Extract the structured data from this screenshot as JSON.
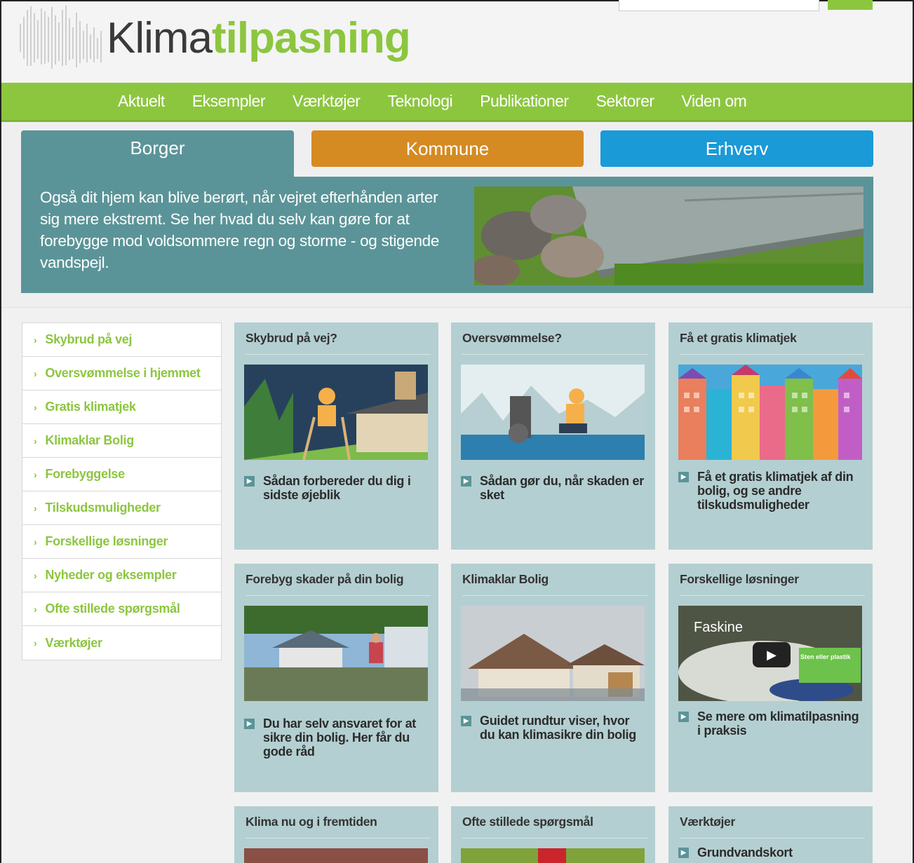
{
  "brand": {
    "logo_part1": "Klima",
    "logo_part2": "tilpasning"
  },
  "nav": [
    "Aktuelt",
    "Eksempler",
    "Værktøjer",
    "Teknologi",
    "Publikationer",
    "Sektorer",
    "Viden om"
  ],
  "tabs": {
    "borger": "Borger",
    "kommune": "Kommune",
    "erhverv": "Erhverv"
  },
  "hero": {
    "text": "Også dit hjem kan blive berørt, når vejret efterhånden arter sig mere ekstremt. Se her hvad du selv kan gøre for at forebygge mod voldsommere regn og storme - og stigende vandspejl."
  },
  "sidebar": [
    "Skybrud på vej",
    "Oversvømmelse i hjemmet",
    "Gratis klimatjek",
    "Klimaklar Bolig",
    "Forebyggelse",
    "Tilskudsmuligheder",
    "Forskellige løsninger",
    "Nyheder og eksempler",
    "Ofte stillede spørgsmål",
    "Værktøjer"
  ],
  "cards": [
    {
      "title": "Skybrud på vej?",
      "link": "Sådan forbereder du dig i sidste øjeblik"
    },
    {
      "title": "Oversvømmelse?",
      "link": "Sådan gør du, når skaden er sket"
    },
    {
      "title": "Få et gratis klimatjek",
      "link": "Få et gratis klimatjek af din bolig, og se andre tilskudsmuligheder"
    },
    {
      "title": "Forebyg skader på din bolig",
      "link": "Du har selv ansvaret for at sikre din bolig. Her får du gode råd"
    },
    {
      "title": "Klimaklar Bolig",
      "link": "Guidet rundtur viser, hvor du kan klimasikre din bolig"
    },
    {
      "title": "Forskellige løsninger",
      "link": "Se mere om klimatilpasning i praksis",
      "video_label": "Faskine",
      "video_badge": "Sten eller plastik"
    },
    {
      "title": "Klima nu og i fremtiden"
    },
    {
      "title": "Ofte stillede spørgsmål"
    },
    {
      "title": "Værktøjer",
      "link": "Grundvandskort"
    }
  ],
  "colors": {
    "green": "#8cc63f",
    "teal": "#5b9498",
    "orange": "#d68a22",
    "blue": "#1a9ad6",
    "card": "#b4cfd1"
  }
}
